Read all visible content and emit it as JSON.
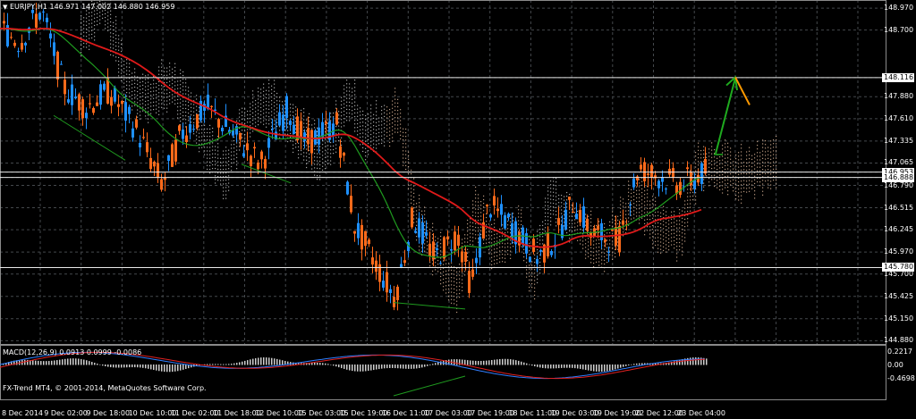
{
  "header": {
    "symbol_icon": "down-triangle-icon",
    "title": "EURJPY,H1",
    "ohlc": "146.971 147.002 146.880 146.959"
  },
  "macd": {
    "label": "MACD(12,26,9) 0.0913 0.0999 -0.0086",
    "scale_top": "0.2217",
    "scale_zero": "0.00",
    "scale_bottom": "-0.4698"
  },
  "copyright": "FX-Trend MT4, © 2001-2014, MetaQuotes Software Corp.",
  "price_axis": [
    "148.970",
    "148.700",
    "148.116",
    "147.880",
    "147.610",
    "147.335",
    "147.065",
    "146.953",
    "146.888",
    "146.790",
    "146.515",
    "146.245",
    "145.970",
    "145.780",
    "145.700",
    "145.425",
    "145.150",
    "144.880"
  ],
  "highlighted_levels": [
    "148.116",
    "146.953",
    "146.888",
    "145.780"
  ],
  "time_axis": [
    "8 Dec 2014",
    "9 Dec 02:00",
    "9 Dec 18:00",
    "10 Dec 10:00",
    "11 Dec 02:00",
    "11 Dec 18:00",
    "12 Dec 10:00",
    "15 Dec 03:00",
    "15 Dec 19:00",
    "16 Dec 11:00",
    "17 Dec 03:00",
    "17 Dec 19:00",
    "18 Dec 11:00",
    "19 Dec 03:00",
    "19 Dec 19:00",
    "22 Dec 12:00",
    "23 Dec 04:00"
  ],
  "colors": {
    "background": "#000000",
    "grid": "#44484c",
    "bull": "#1e90ff",
    "bear": "#ff6a1a",
    "ma_slow": "#e01a1a",
    "ma_fast": "#1f9b1f",
    "cloud": "#f4c9a8",
    "cloud_alt": "#dcdcdc",
    "arrow_up": "#1faa1f",
    "arrow_down": "#ff9a00"
  }
}
